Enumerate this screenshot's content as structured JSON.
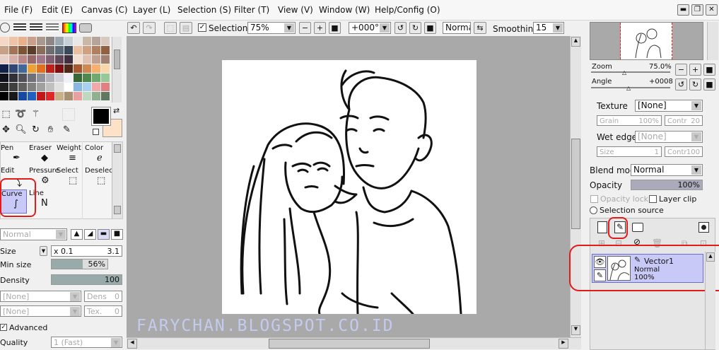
{
  "menu": [
    "File (F)",
    "Edit (E)",
    "Canvas (C)",
    "Layer (L)",
    "Selection (S)",
    "Filter (T)",
    "View (V)",
    "Window (W)",
    "Help/Config (O)"
  ],
  "window_controls": [
    "minimize-icon",
    "restore-icon",
    "close-icon"
  ],
  "toolbar": {
    "selection_label": "Selection",
    "selection_checked": true,
    "zoom": "75%",
    "rotation": "+000°",
    "blend": "Normal",
    "smoothing_label": "Smoothing",
    "smoothing": "15"
  },
  "brush_tabs": [
    "Pen",
    "Eraser",
    "Weight",
    "Color",
    "Edit",
    "Pressure",
    "Select",
    "Deselect",
    "Curve",
    "Line"
  ],
  "tool_settings": {
    "blend": "Normal",
    "size_label": "Size",
    "size_mult": "x 0.1",
    "size_value": "3.1",
    "min_size_label": "Min size",
    "min_size_value": "56%",
    "density_label": "Density",
    "density_value": "100",
    "texture1": "[None]",
    "dens_label": "Dens",
    "dens_value": "0",
    "texture2": "[None]",
    "tex_label": "Tex.",
    "tex_value": "0",
    "advanced_label": "Advanced",
    "advanced_checked": true,
    "quality_label": "Quality",
    "quality_value": "1 (Fast)"
  },
  "navigator": {
    "zoom_label": "Zoom",
    "zoom_value": "75.0%",
    "angle_label": "Angle",
    "angle_value": "+0008"
  },
  "layer_props": {
    "texture_label": "Texture",
    "texture_value": "[None]",
    "grain_label": "Grain",
    "grain_value": "100%",
    "contr_label": "Contr",
    "contr_value": "20",
    "wet_edge_label": "Wet edge",
    "wet_edge_value": "[None]",
    "size_label": "Size",
    "size_value": "1",
    "contr2_label": "Contr",
    "contr2_value": "100",
    "blend_mode_label": "Blend mode",
    "blend_mode_value": "Normal",
    "opacity_label": "Opacity",
    "opacity_value": "100%",
    "opacity_lock_label": "Opacity lock",
    "layer_clip_label": "Layer clip",
    "selection_source_label": "Selection source"
  },
  "layers": [
    {
      "name": "Vector1",
      "blend": "Normal",
      "opacity": "100%"
    }
  ],
  "watermark": "FARYCHAN.BLOGSPOT.CO.ID",
  "colors": {
    "primary": "#000000",
    "secondary": "#fde2c7",
    "highlight": "#e21b1b",
    "layer_selected": "#c9c9f7",
    "canvas_bg": "#a9a9a9"
  }
}
